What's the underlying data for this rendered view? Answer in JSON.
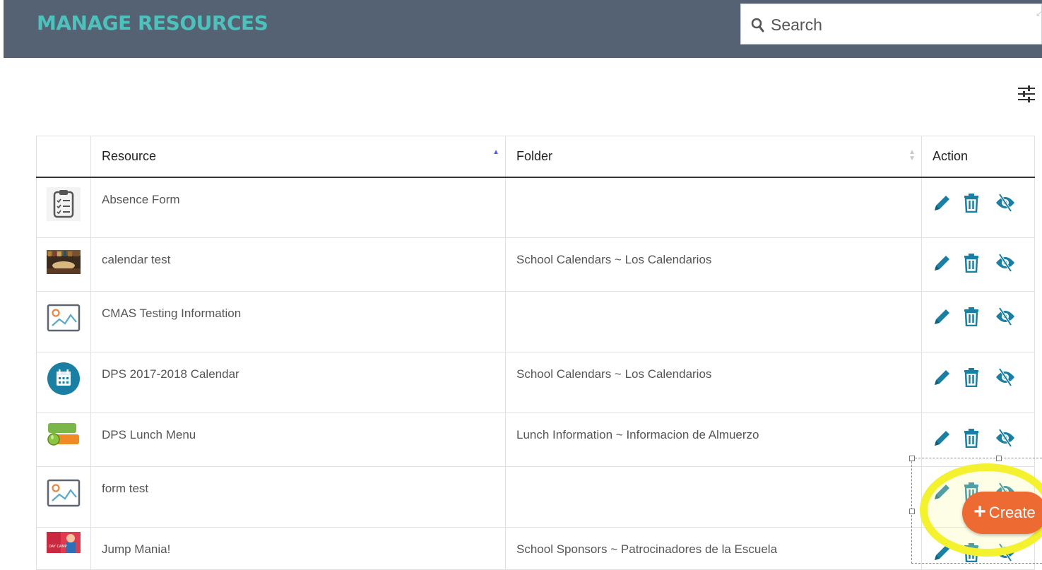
{
  "header": {
    "title": "MANAGE RESOURCES",
    "search_placeholder": "Search"
  },
  "colors": {
    "header_bg": "#546273",
    "title": "#4dc2bc",
    "action_icon": "#1a7fa3",
    "create_button": "#ed6a33",
    "highlight": "#f4f22e"
  },
  "table": {
    "columns": [
      "",
      "Resource",
      "Folder",
      "Action"
    ],
    "sort": {
      "column": "Resource",
      "direction": "ascending"
    },
    "rows": [
      {
        "thumbnail": "clipboard-checklist-icon",
        "resource": "Absence Form",
        "folder": ""
      },
      {
        "thumbnail": "library-photo",
        "resource": "calendar test",
        "folder": "School Calendars ~ Los Calendarios"
      },
      {
        "thumbnail": "image-placeholder-icon",
        "resource": "CMAS Testing Information",
        "folder": ""
      },
      {
        "thumbnail": "calendar-circle-icon",
        "resource": "DPS 2017-2018 Calendar",
        "folder": "School Calendars ~ Los Calendarios"
      },
      {
        "thumbnail": "school-lunch-logo",
        "resource": "DPS Lunch Menu",
        "folder": "Lunch Information ~ Informacion de Almuerzo"
      },
      {
        "thumbnail": "image-placeholder-icon",
        "resource": "form test",
        "folder": ""
      },
      {
        "thumbnail": "day-camp-photo",
        "resource": "Jump Mania!",
        "folder": "School Sponsors ~ Patrocinadores de la Escuela"
      }
    ],
    "action_icons": [
      "pencil-icon",
      "trash-icon",
      "hide-eye-icon"
    ]
  },
  "create_button": {
    "label": "Create",
    "icon": "plus-icon"
  },
  "filter_icon": "sliders-icon"
}
